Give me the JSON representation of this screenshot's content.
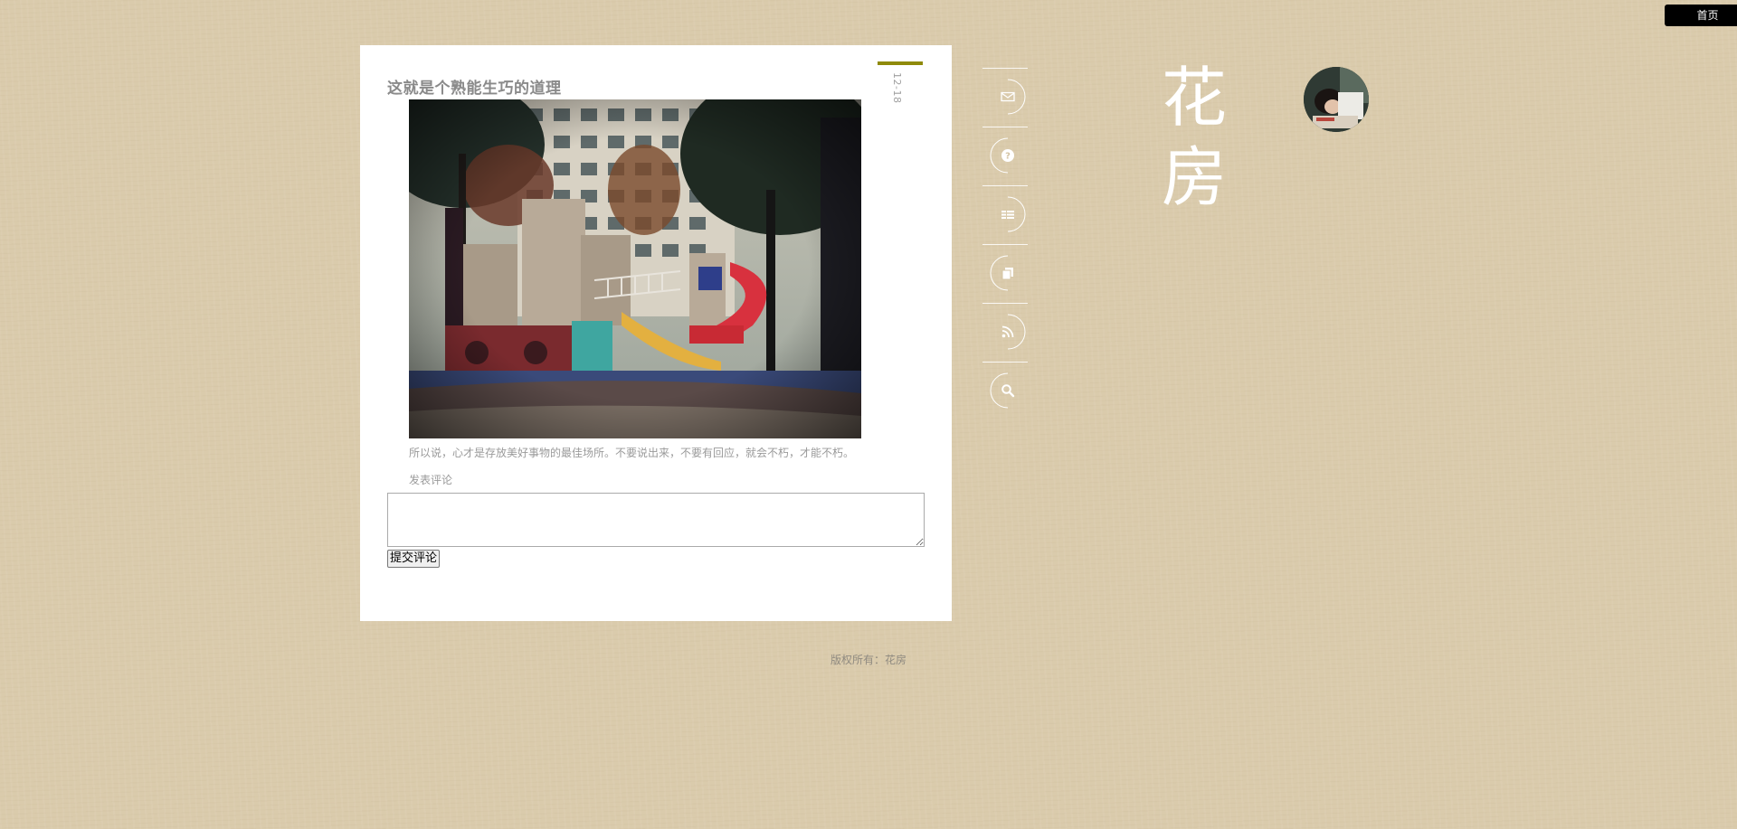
{
  "header": {
    "home_label": "首页"
  },
  "post": {
    "title": "这就是个熟能生巧的道理",
    "date": "12-18",
    "body": "所以说，心才是存放美好事物的最佳场所。不要说出来，不要有回应，就会不朽，才能不朽。",
    "comment_label": "发表评论",
    "comment_value": "",
    "submit_label": "提交评论"
  },
  "footer": {
    "copyright": "版权所有：花房"
  },
  "site": {
    "title_chars": [
      "花",
      "房"
    ]
  },
  "nav": {
    "icons": [
      "mail-icon",
      "question-icon",
      "list-icon",
      "archive-icon",
      "rss-icon",
      "search-icon"
    ]
  },
  "colors": {
    "background": "#dacbac",
    "card": "#ffffff",
    "date_accent": "#8f8a0a",
    "muted_text": "#9a9a9a"
  }
}
